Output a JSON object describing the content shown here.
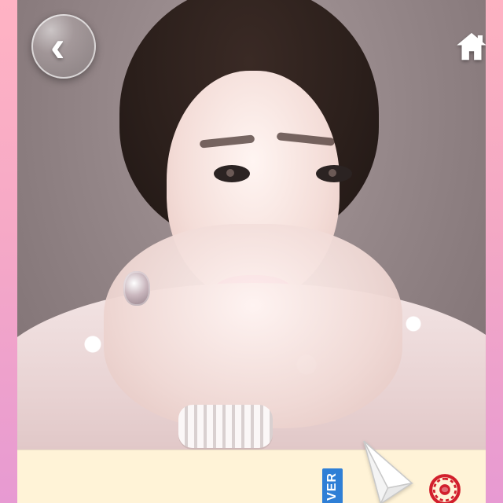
{
  "controls": {
    "back_glyph": "‹",
    "home_icon": "home-icon"
  },
  "bottom_bar": {
    "ver_text": "VER",
    "plane_icon": "paper-plane-icon",
    "logo_icon": "red-round-logo-icon",
    "colors": {
      "bar_bg": "#fff3d7",
      "ver_bg": "#2f7fd6",
      "logo_red": "#d21f2c"
    }
  },
  "photo": {
    "subject": "portrait"
  }
}
